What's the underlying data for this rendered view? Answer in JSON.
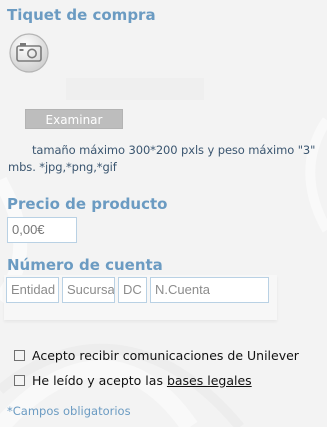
{
  "receipt": {
    "heading": "Tiquet de compra",
    "upload_icon": "camera-icon",
    "browse_label": "Examinar",
    "hint_line1": "tamaño máximo 300*200 pxls y peso máximo \"3\"",
    "hint_line2": "mbs. *jpg,*png,*gif"
  },
  "price": {
    "heading": "Precio de producto",
    "value": "0,00€"
  },
  "account": {
    "heading": "Número de cuenta",
    "fields": [
      {
        "placeholder": "Entidad"
      },
      {
        "placeholder": "Sucursal"
      },
      {
        "placeholder": "DC"
      },
      {
        "placeholder": "N.Cuenta"
      }
    ]
  },
  "consents": {
    "communications_label": "Acepto recibir comunicaciones de Unilever",
    "legal_prefix": "He leído y acepto las",
    "legal_link": "bases legales"
  },
  "required_note": "*Campos obligatorios",
  "colors": {
    "heading": "#6b9bc2",
    "button": "#bdbdbd",
    "field_border": "#b9d1e4"
  }
}
